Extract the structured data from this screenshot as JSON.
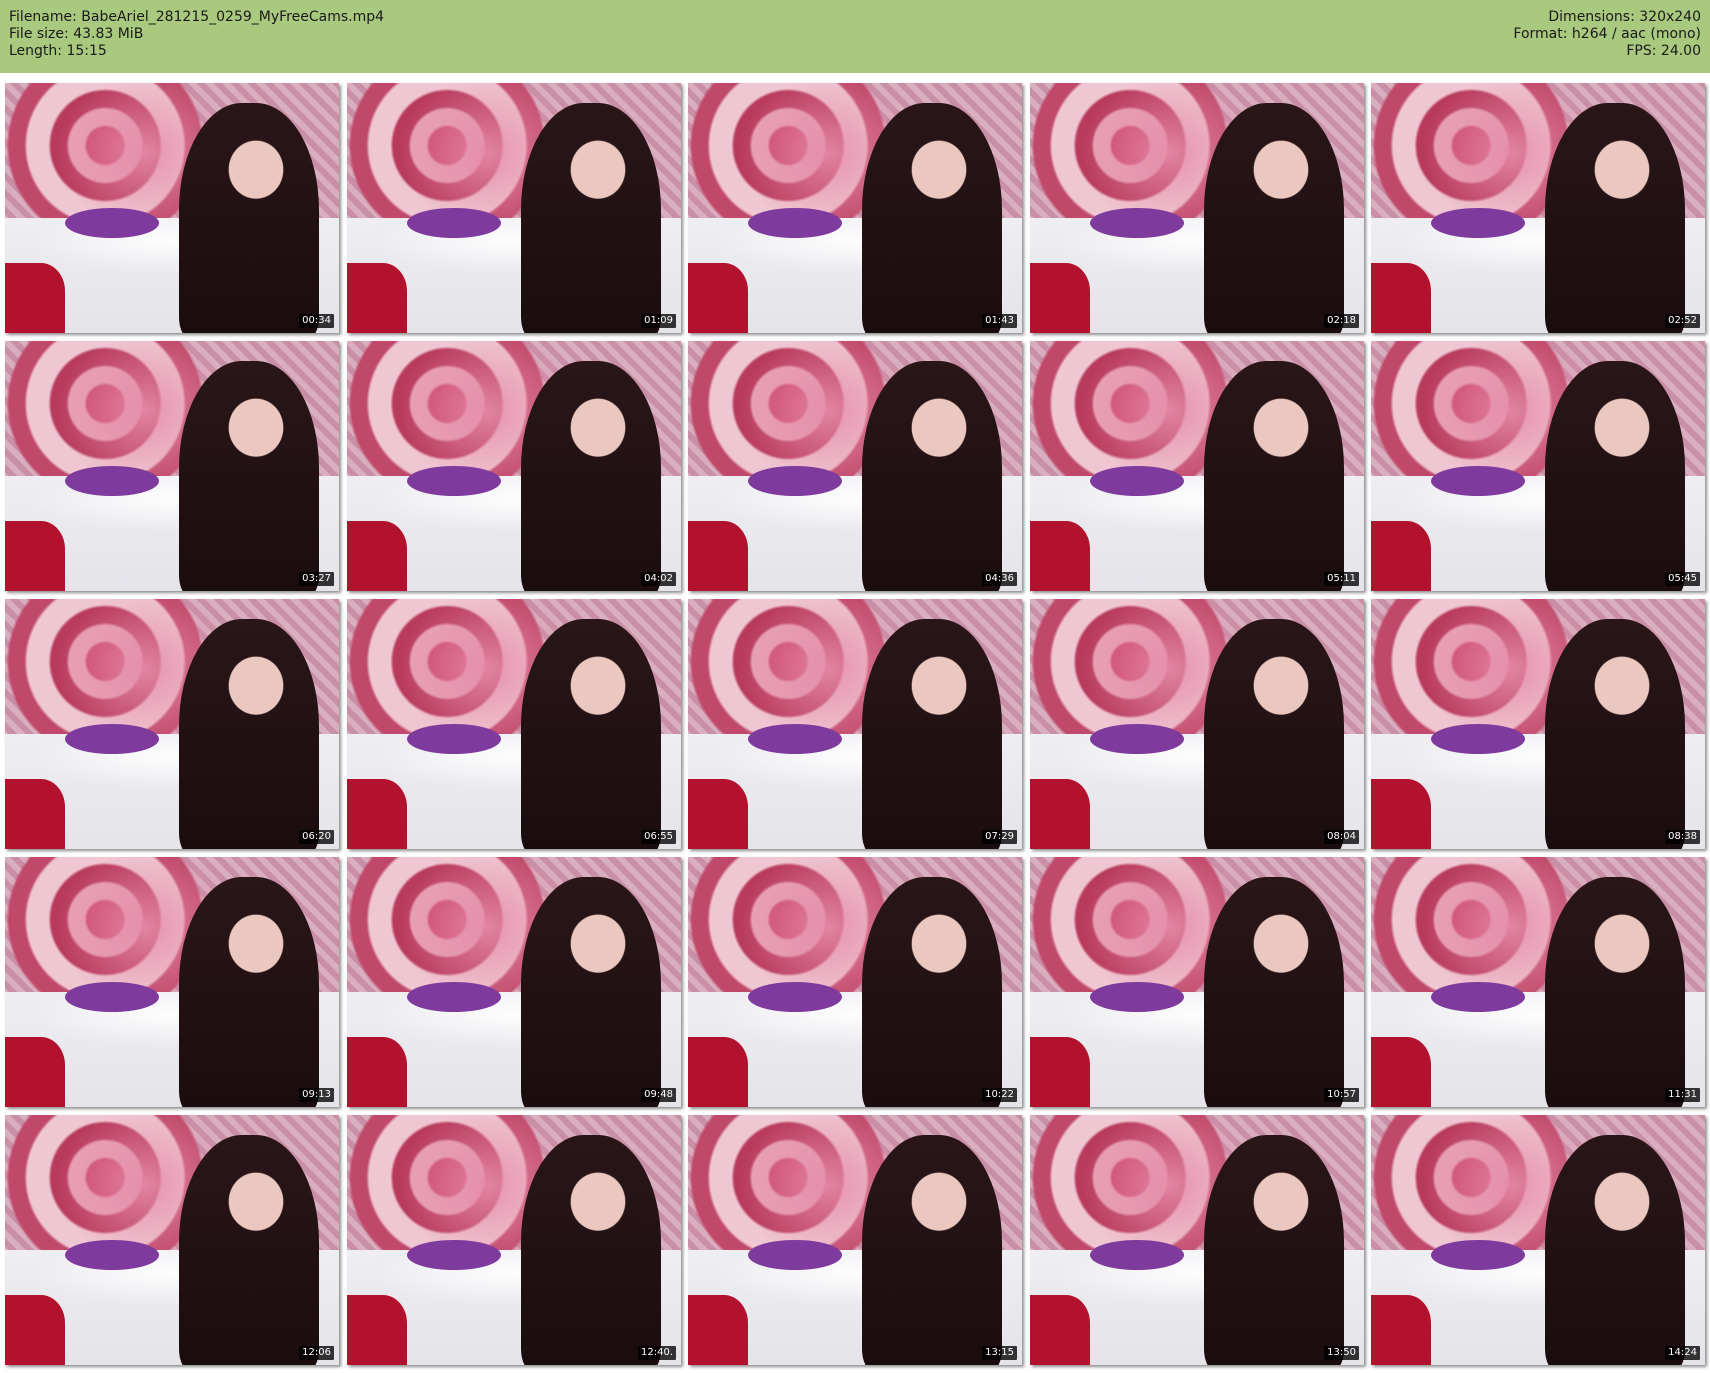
{
  "header": {
    "filename": "Filename: BabeAriel_281215_0259_MyFreeCams.mp4",
    "filesize": "File size: 43.83 MiB",
    "length": "Length: 15:15",
    "dimensions": "Dimensions: 320x240",
    "format": "Format: h264 / aac (mono)",
    "fps": "FPS: 24.00"
  },
  "colors": {
    "header_background": "#a8c97e",
    "page_background": "#ffffff",
    "timestamp_background": "#000000",
    "timestamp_text": "#ffffff"
  },
  "grid": {
    "rows": 5,
    "columns": 5
  },
  "timestamps": [
    "00:34",
    "01:09",
    "01:43",
    "02:18",
    "02:52",
    "03:27",
    "04:02",
    "04:36",
    "05:11",
    "05:45",
    "06:20",
    "06:55",
    "07:29",
    "08:04",
    "08:38",
    "09:13",
    "09:48",
    "10:22",
    "10:57",
    "11:31",
    "12:06",
    "12:40.",
    "13:15",
    "13:50",
    "14:24"
  ]
}
